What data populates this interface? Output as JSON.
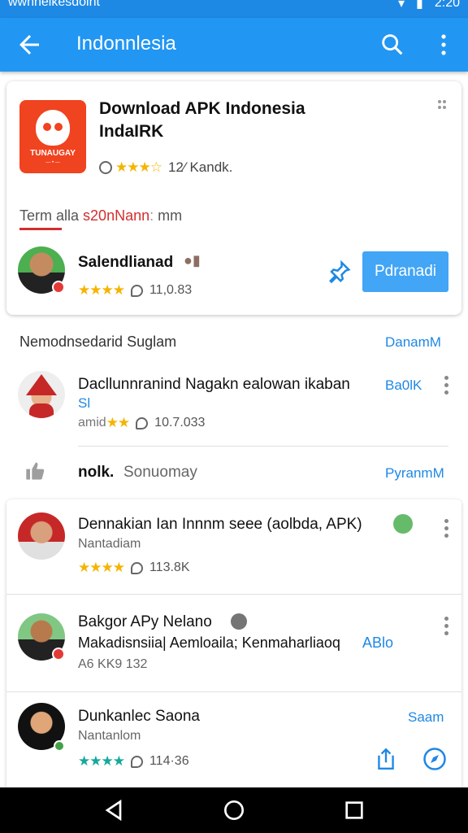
{
  "status_bar": {
    "left_text": "wwnnelkesdoint",
    "time": "2:20"
  },
  "app_bar": {
    "title": "Indonnlesia",
    "back_icon": "arrow-back-icon",
    "search_icon": "search-icon",
    "more_icon": "more-vert-icon"
  },
  "featured": {
    "title_line1": "Download APK Indonesia",
    "title_line2": "IndaIRK",
    "rating_count": "12⁄ Kandk.",
    "logo_text": "TUNAUGAY",
    "logo_sub": "— • —",
    "term_label": "Term alla",
    "term_highlight": "s20nNann",
    "term_suffix": "mm",
    "publisher_name": "Salendlianad",
    "publisher_count": "11,0.83",
    "install_label": "Pdranadi"
  },
  "section": {
    "heading": "Nemodnsedarid Suglam",
    "link": "DanamM"
  },
  "list": [
    {
      "name": "Dacllunnranind Nagakn ealowan ikaban",
      "name_cont": "Sl",
      "action": "Ba0lK",
      "sub": "amid",
      "count": "10.7.033"
    },
    {
      "name": "nolk.",
      "sub": "Sonuomay",
      "action": "PyranmM"
    }
  ],
  "cards": [
    {
      "name": "Dennakian Ian Innnm seee (aolbda, APK)",
      "sub": "Nantadiam",
      "count": "113.8K"
    },
    {
      "name": "Bakgor APy Nelano",
      "sub": "Makadisnsiia| Aemloaila; Kenmaharliaoq",
      "action": "ABlo",
      "count": "A6 KK9 132"
    },
    {
      "name": "Dunkanlec Saona",
      "sub": "Nantanlom",
      "action": "Saam",
      "count": "114·36"
    }
  ],
  "colors": {
    "accent": "#2196f3",
    "install": "#42a5f5",
    "star": "#f5b400",
    "red": "#d32f2f"
  }
}
